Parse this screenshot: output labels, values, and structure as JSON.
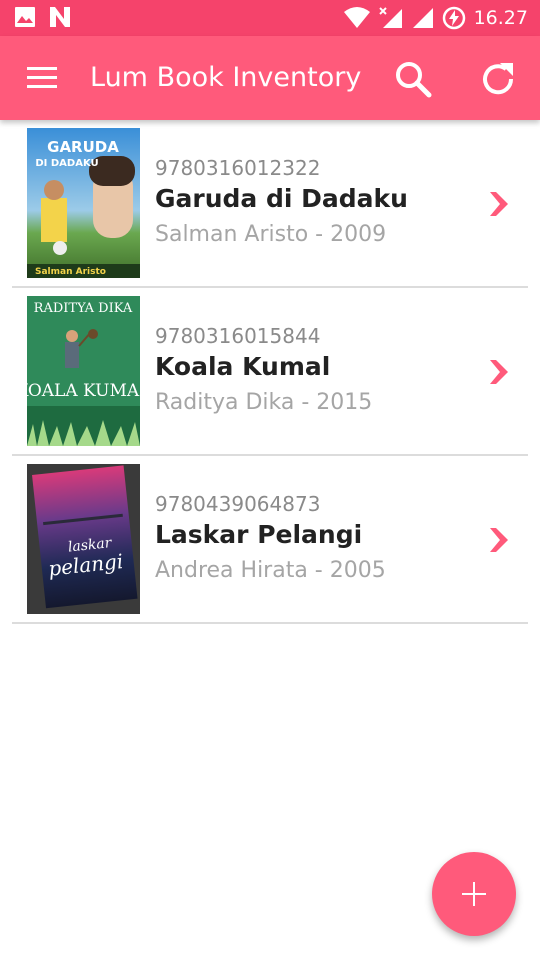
{
  "status_bar": {
    "time": "16.27",
    "icons": [
      "gallery-icon",
      "n-notification-icon",
      "wifi-icon",
      "mobile-data-off-icon",
      "signal-icon",
      "battery-charging-icon"
    ]
  },
  "toolbar": {
    "title": "Lum Book Inventory",
    "menu_icon": "hamburger-menu-icon",
    "search_icon": "search-icon",
    "refresh_icon": "refresh-icon"
  },
  "colors": {
    "accent": "#ff5a7b",
    "status_bar": "#f5436b"
  },
  "books": [
    {
      "isbn": "9780316012322",
      "title": "Garuda di Dadaku",
      "meta": "Salman Aristo - 2009",
      "cover_title": "GARUDA",
      "cover_subtitle": "DI DADAKU",
      "cover_author": "Salman Aristo"
    },
    {
      "isbn": "9780316015844",
      "title": "Koala Kumal",
      "meta": "Raditya Dika - 2015",
      "cover_title": "RADITYA DIKA",
      "cover_subtitle": "KOALA KUMAL"
    },
    {
      "isbn": "9780439064873",
      "title": "Laskar Pelangi",
      "meta": "Andrea Hirata - 2005",
      "cover_title": "laskar",
      "cover_subtitle": "pelangi"
    }
  ],
  "fab": {
    "icon": "plus-icon"
  }
}
